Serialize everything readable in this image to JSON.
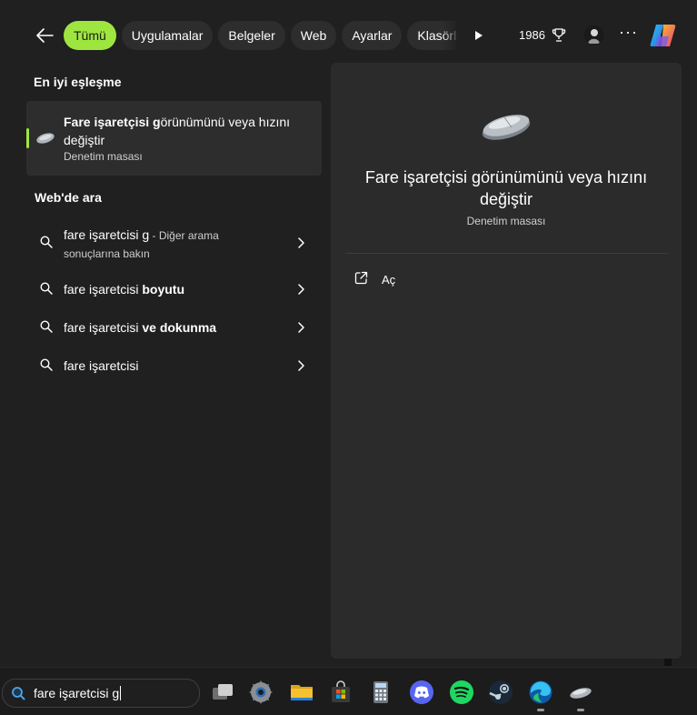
{
  "top_bar": {
    "back_label": "Back",
    "filters": [
      "Tümü",
      "Uygulamalar",
      "Belgeler",
      "Web",
      "Ayarlar",
      "Klasörler"
    ],
    "active_filter": "Tümü",
    "points": "1986"
  },
  "best_match": {
    "section_title": "En iyi eşleşme",
    "title_bold": "Fare işaretçisi g",
    "title_rest": "örünümünü veya hızını değiştir",
    "subtitle": "Denetim masası"
  },
  "web_search": {
    "section_title": "Web'de ara",
    "items": [
      {
        "query": "fare işaretcisi g",
        "suffix": " - Diğer arama",
        "second_line": "sonuçlarına bakın"
      },
      {
        "query": "fare işaretcisi ",
        "bold": "boyutu"
      },
      {
        "query": "fare işaretcisi ",
        "bold": "ve dokunma"
      },
      {
        "query": "fare işaretcisi",
        "bold": ""
      }
    ]
  },
  "preview": {
    "title": "Fare işaretçisi görünümünü veya hızını değiştir",
    "subtitle": "Denetim masası",
    "open_label": "Aç"
  },
  "taskbar": {
    "search_value": "fare işaretcisi g",
    "apps": [
      "task-view-icon",
      "settings-icon",
      "file-explorer-icon",
      "microsoft-store-icon",
      "calculator-icon",
      "discord-icon",
      "spotify-icon",
      "steam-icon",
      "edge-icon",
      "mouse-settings-icon"
    ]
  },
  "colors": {
    "accent": "#9ee63f",
    "background": "#202020",
    "surface": "#2d2d2d"
  }
}
